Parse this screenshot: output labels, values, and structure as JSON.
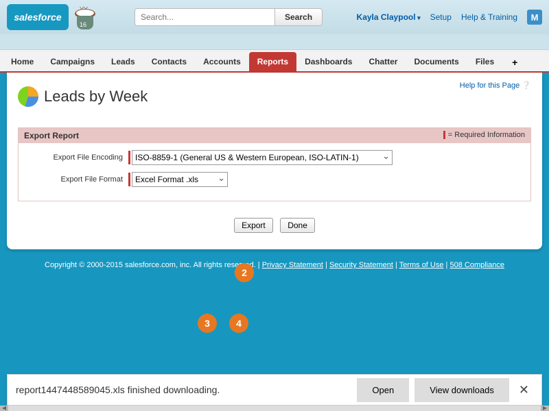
{
  "header": {
    "logo_text": "salesforce",
    "mug_number": "16",
    "search_placeholder": "Search...",
    "search_button": "Search",
    "username": "Kayla Claypool",
    "link_setup": "Setup",
    "link_help": "Help & Training"
  },
  "tabs": [
    "Home",
    "Campaigns",
    "Leads",
    "Contacts",
    "Accounts",
    "Reports",
    "Dashboards",
    "Chatter",
    "Documents",
    "Files"
  ],
  "active_tab": "Reports",
  "page": {
    "help_link": "Help for this Page",
    "title": "Leads by Week"
  },
  "panel": {
    "title": "Export Report",
    "required_text": "= Required Information",
    "encoding_label": "Export File Encoding",
    "encoding_value": "ISO-8859-1 (General US & Western European, ISO-LATIN-1)",
    "format_label": "Export File Format",
    "format_value": "Excel Format .xls",
    "export_btn": "Export",
    "done_btn": "Done"
  },
  "bubbles": {
    "b2": "2",
    "b3": "3",
    "b4": "4"
  },
  "footer": {
    "copyright": "Copyright © 2000-2015 salesforce.com, inc. All rights reserved.",
    "privacy": "Privacy Statement",
    "security": "Security Statement",
    "terms": "Terms of Use",
    "compliance": "508 Compliance"
  },
  "download": {
    "message": "report1447448589045.xls finished downloading.",
    "open": "Open",
    "view": "View downloads"
  }
}
